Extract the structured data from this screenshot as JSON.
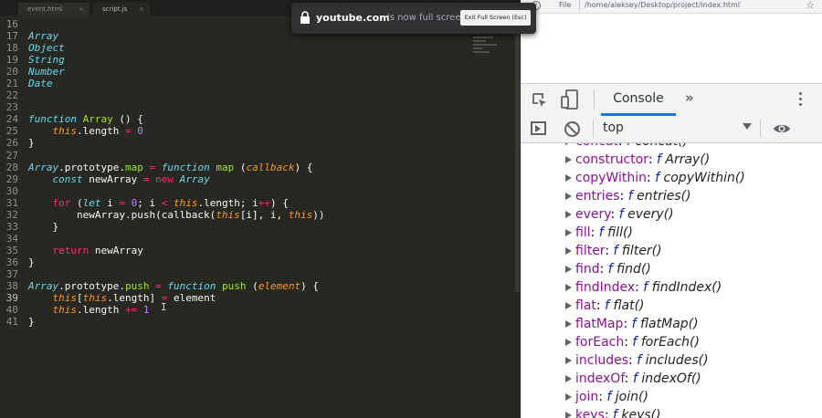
{
  "editor": {
    "tabs": [
      {
        "label": "event.html"
      },
      {
        "label": "script.js"
      }
    ],
    "lines": [
      {
        "n": "16",
        "tokens": []
      },
      {
        "n": "17",
        "tokens": [
          {
            "t": "Array",
            "c": "c-st"
          }
        ]
      },
      {
        "n": "18",
        "tokens": [
          {
            "t": "Object",
            "c": "c-st"
          }
        ]
      },
      {
        "n": "19",
        "tokens": [
          {
            "t": "String",
            "c": "c-st"
          }
        ]
      },
      {
        "n": "20",
        "tokens": [
          {
            "t": "Number",
            "c": "c-st"
          }
        ]
      },
      {
        "n": "21",
        "tokens": [
          {
            "t": "Date",
            "c": "c-st"
          }
        ]
      },
      {
        "n": "22",
        "tokens": []
      },
      {
        "n": "23",
        "tokens": []
      },
      {
        "n": "24",
        "tokens": [
          {
            "t": "function",
            "c": "c-st"
          },
          {
            "t": " "
          },
          {
            "t": "Array",
            "c": "c-fn"
          },
          {
            "t": " () {"
          }
        ]
      },
      {
        "n": "25",
        "tokens": [
          {
            "t": "    "
          },
          {
            "t": "this",
            "c": "c-th"
          },
          {
            "t": ".length "
          },
          {
            "t": "=",
            "c": "c-kw"
          },
          {
            "t": " "
          },
          {
            "t": "0",
            "c": "c-nu"
          }
        ]
      },
      {
        "n": "26",
        "tokens": [
          {
            "t": "}"
          }
        ]
      },
      {
        "n": "27",
        "tokens": []
      },
      {
        "n": "28",
        "tokens": [
          {
            "t": "Array",
            "c": "c-st"
          },
          {
            "t": ".prototype."
          },
          {
            "t": "map",
            "c": "c-fn"
          },
          {
            "t": " "
          },
          {
            "t": "=",
            "c": "c-kw"
          },
          {
            "t": " "
          },
          {
            "t": "function",
            "c": "c-st"
          },
          {
            "t": " "
          },
          {
            "t": "map",
            "c": "c-fn"
          },
          {
            "t": " ("
          },
          {
            "t": "callback",
            "c": "c-ar"
          },
          {
            "t": ") {"
          }
        ]
      },
      {
        "n": "29",
        "tokens": [
          {
            "t": "    "
          },
          {
            "t": "const",
            "c": "c-st"
          },
          {
            "t": " newArray "
          },
          {
            "t": "=",
            "c": "c-kw"
          },
          {
            "t": " "
          },
          {
            "t": "new",
            "c": "c-kw"
          },
          {
            "t": " "
          },
          {
            "t": "Array",
            "c": "c-st"
          }
        ]
      },
      {
        "n": "30",
        "tokens": []
      },
      {
        "n": "31",
        "tokens": [
          {
            "t": "    "
          },
          {
            "t": "for",
            "c": "c-kw"
          },
          {
            "t": " ("
          },
          {
            "t": "let",
            "c": "c-st"
          },
          {
            "t": " i "
          },
          {
            "t": "=",
            "c": "c-kw"
          },
          {
            "t": " "
          },
          {
            "t": "0",
            "c": "c-nu"
          },
          {
            "t": "; i "
          },
          {
            "t": "<",
            "c": "c-kw"
          },
          {
            "t": " "
          },
          {
            "t": "this",
            "c": "c-th"
          },
          {
            "t": ".length; i"
          },
          {
            "t": "++",
            "c": "c-kw"
          },
          {
            "t": ") {"
          }
        ]
      },
      {
        "n": "32",
        "tokens": [
          {
            "t": "        newArray.push(callback("
          },
          {
            "t": "this",
            "c": "c-th"
          },
          {
            "t": "[i], i, "
          },
          {
            "t": "this",
            "c": "c-th"
          },
          {
            "t": "))"
          }
        ]
      },
      {
        "n": "33",
        "tokens": [
          {
            "t": "    }"
          }
        ]
      },
      {
        "n": "34",
        "tokens": []
      },
      {
        "n": "35",
        "tokens": [
          {
            "t": "    "
          },
          {
            "t": "return",
            "c": "c-kw"
          },
          {
            "t": " newArray"
          }
        ]
      },
      {
        "n": "36",
        "tokens": [
          {
            "t": "}"
          }
        ]
      },
      {
        "n": "37",
        "tokens": []
      },
      {
        "n": "38",
        "tokens": [
          {
            "t": "Array",
            "c": "c-st"
          },
          {
            "t": ".prototype."
          },
          {
            "t": "push",
            "c": "c-fn"
          },
          {
            "t": " "
          },
          {
            "t": "=",
            "c": "c-kw"
          },
          {
            "t": " "
          },
          {
            "t": "function",
            "c": "c-st"
          },
          {
            "t": " "
          },
          {
            "t": "push",
            "c": "c-fn"
          },
          {
            "t": " ("
          },
          {
            "t": "element",
            "c": "c-ar"
          },
          {
            "t": ") {"
          }
        ]
      },
      {
        "n": "39",
        "tokens": [
          {
            "t": "    "
          },
          {
            "t": "this",
            "c": "c-th"
          },
          {
            "t": "["
          },
          {
            "t": "this",
            "c": "c-th"
          },
          {
            "t": ".length] "
          },
          {
            "t": "=",
            "c": "c-kw"
          },
          {
            "t": " element"
          }
        ]
      },
      {
        "n": "40",
        "tokens": [
          {
            "t": "    "
          },
          {
            "t": "this",
            "c": "c-th"
          },
          {
            "t": ".length "
          },
          {
            "t": "+=",
            "c": "c-kw"
          },
          {
            "t": " "
          },
          {
            "t": "1",
            "c": "c-nu"
          }
        ]
      },
      {
        "n": "41",
        "tokens": [
          {
            "t": "}"
          }
        ]
      }
    ],
    "cursor_glyph": "I"
  },
  "notification": {
    "domain": "youtube.com",
    "message": "is now full screen",
    "button": "Exit Full Screen (Esc)"
  },
  "browser": {
    "scheme": "File",
    "path": "/home/aleksey/Desktop/project/index.html",
    "star": "☆"
  },
  "devtools": {
    "active_tab": "Console",
    "more_tabs": "»",
    "context": "top",
    "rows": [
      {
        "key": "concat",
        "sep": ": ",
        "f": "f",
        "val": "concat()"
      },
      {
        "key": "constructor",
        "sep": ": ",
        "f": "f",
        "val": "Array()"
      },
      {
        "key": "copyWithin",
        "sep": ": ",
        "f": "f",
        "val": "copyWithin()"
      },
      {
        "key": "entries",
        "sep": ": ",
        "f": "f",
        "val": "entries()"
      },
      {
        "key": "every",
        "sep": ": ",
        "f": "f",
        "val": "every()"
      },
      {
        "key": "fill",
        "sep": ": ",
        "f": "f",
        "val": "fill()"
      },
      {
        "key": "filter",
        "sep": ": ",
        "f": "f",
        "val": "filter()"
      },
      {
        "key": "find",
        "sep": ": ",
        "f": "f",
        "val": "find()"
      },
      {
        "key": "findIndex",
        "sep": ": ",
        "f": "f",
        "val": "findIndex()"
      },
      {
        "key": "flat",
        "sep": ": ",
        "f": "f",
        "val": "flat()"
      },
      {
        "key": "flatMap",
        "sep": ": ",
        "f": "f",
        "val": "flatMap()"
      },
      {
        "key": "forEach",
        "sep": ": ",
        "f": "f",
        "val": "forEach()"
      },
      {
        "key": "includes",
        "sep": ": ",
        "f": "f",
        "val": "includes()"
      },
      {
        "key": "indexOf",
        "sep": ": ",
        "f": "f",
        "val": "indexOf()"
      },
      {
        "key": "join",
        "sep": ": ",
        "f": "f",
        "val": "join()"
      },
      {
        "key": "keys",
        "sep": ": ",
        "f": "f",
        "val": "keys()"
      }
    ]
  }
}
